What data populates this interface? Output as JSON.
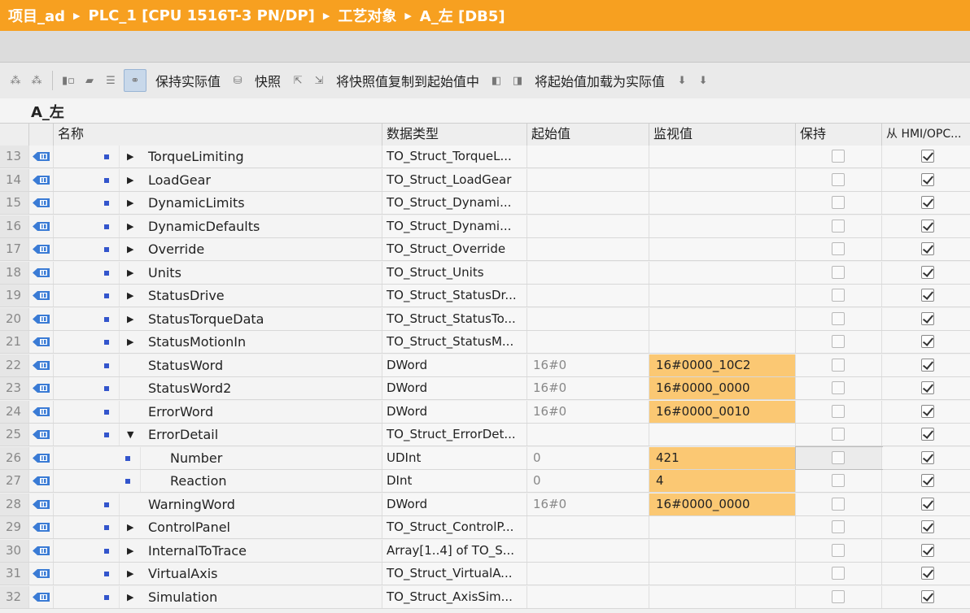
{
  "breadcrumb": [
    "项目_ad",
    "PLC_1 [CPU 1516T-3 PN/DP]",
    "工艺对象",
    "A_左 [DB5]"
  ],
  "toolbar": {
    "keep_actual": "保持实际值",
    "snapshot": "快照",
    "copy_snapshot": "将快照值复制到起始值中",
    "load_start": "将起始值加载为实际值"
  },
  "object_name": "A_左",
  "columns": {
    "name": "名称",
    "type": "数据类型",
    "start": "起始值",
    "monitor": "监视值",
    "retain": "保持",
    "hmi": "从 HMI/OPC..."
  },
  "rows": [
    {
      "num": "13",
      "level": 1,
      "expand": "collapsed",
      "name": "TorqueLimiting",
      "type": "TO_Struct_TorqueL...",
      "start": "",
      "monitor": "",
      "retain": false,
      "hmi": true
    },
    {
      "num": "14",
      "level": 1,
      "expand": "collapsed",
      "name": "LoadGear",
      "type": "TO_Struct_LoadGear",
      "start": "",
      "monitor": "",
      "retain": false,
      "hmi": true
    },
    {
      "num": "15",
      "level": 1,
      "expand": "collapsed",
      "name": "DynamicLimits",
      "type": "TO_Struct_Dynami...",
      "start": "",
      "monitor": "",
      "retain": false,
      "hmi": true
    },
    {
      "num": "16",
      "level": 1,
      "expand": "collapsed",
      "name": "DynamicDefaults",
      "type": "TO_Struct_Dynami...",
      "start": "",
      "monitor": "",
      "retain": false,
      "hmi": true
    },
    {
      "num": "17",
      "level": 1,
      "expand": "collapsed",
      "name": "Override",
      "type": "TO_Struct_Override",
      "start": "",
      "monitor": "",
      "retain": false,
      "hmi": true
    },
    {
      "num": "18",
      "level": 1,
      "expand": "collapsed",
      "name": "Units",
      "type": "TO_Struct_Units",
      "start": "",
      "monitor": "",
      "retain": false,
      "hmi": true
    },
    {
      "num": "19",
      "level": 1,
      "expand": "collapsed",
      "name": "StatusDrive",
      "type": "TO_Struct_StatusDr...",
      "start": "",
      "monitor": "",
      "retain": false,
      "hmi": true
    },
    {
      "num": "20",
      "level": 1,
      "expand": "collapsed",
      "name": "StatusTorqueData",
      "type": "TO_Struct_StatusTo...",
      "start": "",
      "monitor": "",
      "retain": false,
      "hmi": true
    },
    {
      "num": "21",
      "level": 1,
      "expand": "collapsed",
      "name": "StatusMotionIn",
      "type": "TO_Struct_StatusM...",
      "start": "",
      "monitor": "",
      "retain": false,
      "hmi": true
    },
    {
      "num": "22",
      "level": 1,
      "expand": "none",
      "name": "StatusWord",
      "type": "DWord",
      "start": "16#0",
      "monitor": "16#0000_10C2",
      "retain": false,
      "hmi": true
    },
    {
      "num": "23",
      "level": 1,
      "expand": "none",
      "name": "StatusWord2",
      "type": "DWord",
      "start": "16#0",
      "monitor": "16#0000_0000",
      "retain": false,
      "hmi": true
    },
    {
      "num": "24",
      "level": 1,
      "expand": "none",
      "name": "ErrorWord",
      "type": "DWord",
      "start": "16#0",
      "monitor": "16#0000_0010",
      "retain": false,
      "hmi": true
    },
    {
      "num": "25",
      "level": 1,
      "expand": "expanded",
      "name": "ErrorDetail",
      "type": "TO_Struct_ErrorDet...",
      "start": "",
      "monitor": "",
      "retain": false,
      "hmi": true
    },
    {
      "num": "26",
      "level": 2,
      "expand": "none",
      "name": "Number",
      "type": "UDInt",
      "start": "0",
      "monitor": "421",
      "retain": false,
      "hmi": true,
      "selected": true
    },
    {
      "num": "27",
      "level": 2,
      "expand": "none",
      "name": "Reaction",
      "type": "DInt",
      "start": "0",
      "monitor": "4",
      "retain": false,
      "hmi": true
    },
    {
      "num": "28",
      "level": 1,
      "expand": "none",
      "name": "WarningWord",
      "type": "DWord",
      "start": "16#0",
      "monitor": "16#0000_0000",
      "retain": false,
      "hmi": true
    },
    {
      "num": "29",
      "level": 1,
      "expand": "collapsed",
      "name": "ControlPanel",
      "type": "TO_Struct_ControlP...",
      "start": "",
      "monitor": "",
      "retain": false,
      "hmi": true
    },
    {
      "num": "30",
      "level": 1,
      "expand": "collapsed",
      "name": "InternalToTrace",
      "type": "Array[1..4] of TO_S...",
      "start": "",
      "monitor": "",
      "retain": false,
      "hmi": true
    },
    {
      "num": "31",
      "level": 1,
      "expand": "collapsed",
      "name": "VirtualAxis",
      "type": "TO_Struct_VirtualA...",
      "start": "",
      "monitor": "",
      "retain": false,
      "hmi": true
    },
    {
      "num": "32",
      "level": 1,
      "expand": "collapsed",
      "name": "Simulation",
      "type": "TO_Struct_AxisSim...",
      "start": "",
      "monitor": "",
      "retain": false,
      "hmi": true
    }
  ],
  "colors": {
    "title_bar": "#f7a020",
    "monitor_highlight": "#fbc873",
    "bullet": "#3355cc"
  }
}
